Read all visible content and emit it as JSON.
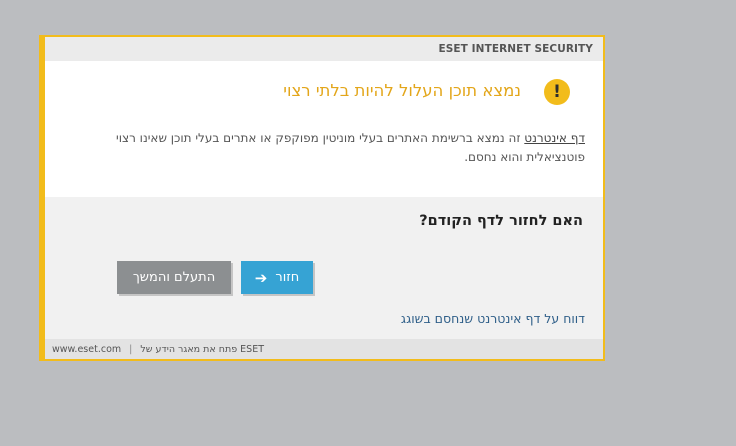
{
  "dialog": {
    "app_title": "ESET INTERNET SECURITY",
    "headline": "נמצא תוכן העלול להיות בלתי רצוי",
    "icon": "warning-exclamation-icon",
    "description": {
      "link_term": "דף אינטרנט",
      "text": " זה נמצא ברשימת האתרים בעלי מוניטין מפוקפק או אתרים בעלי תוכן שאינו רצוי פוטנציאלית והוא נחסם."
    },
    "question": "האם לחזור לדף הקודם?",
    "buttons": {
      "back_label": "חזור",
      "ignore_label": "התעלם והמשך"
    },
    "report_link": "דווח על דף אינטרנט שנחסם בשוגג",
    "footer": {
      "site": "www.eset.com",
      "separator": "|",
      "kb_link": "פתח את מאגר הידע של ESET"
    },
    "colors": {
      "accent": "#f2bc1b",
      "headline": "#e3a61a",
      "primary_button": "#36a3d4",
      "secondary_button": "#8c8f91",
      "link": "#2f5f89"
    }
  }
}
